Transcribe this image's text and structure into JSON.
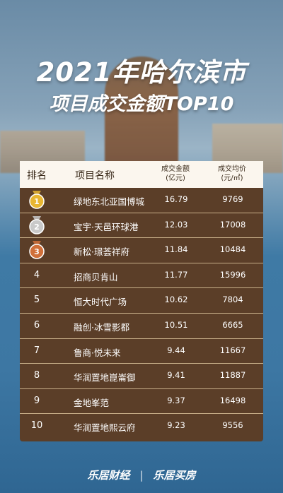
{
  "header": {
    "title_line1": "2021年哈尔滨市",
    "title_line2": "项目成交金额TOP10"
  },
  "table": {
    "columns": {
      "rank": "排名",
      "name": "项目名称",
      "amount_line1": "成交金额",
      "amount_line2": "(亿元)",
      "price_line1": "成交均价",
      "price_line2": "(元/㎡)"
    },
    "rows": [
      {
        "rank": "1",
        "name": "绿地东北亚国博城",
        "amount": "16.79",
        "price": "9769",
        "medal": "gold"
      },
      {
        "rank": "2",
        "name": "宝宇·天邑环球港",
        "amount": "12.03",
        "price": "17008",
        "medal": "silver"
      },
      {
        "rank": "3",
        "name": "新松·璟荟祥府",
        "amount": "11.84",
        "price": "10484",
        "medal": "bronze"
      },
      {
        "rank": "4",
        "name": "招商贝肯山",
        "amount": "11.77",
        "price": "15996"
      },
      {
        "rank": "5",
        "name": "恒大时代广场",
        "amount": "10.62",
        "price": "7804"
      },
      {
        "rank": "6",
        "name": "融创·冰雪影都",
        "amount": "10.51",
        "price": "6665"
      },
      {
        "rank": "7",
        "name": "鲁商·悦未来",
        "amount": "9.44",
        "price": "11667"
      },
      {
        "rank": "8",
        "name": "华润置地崑崙御",
        "amount": "9.41",
        "price": "11887"
      },
      {
        "rank": "9",
        "name": "金地峯范",
        "amount": "9.37",
        "price": "16498"
      },
      {
        "rank": "10",
        "name": "华润置地熙云府",
        "amount": "9.23",
        "price": "9556"
      }
    ]
  },
  "footer": {
    "brand1": "乐居财经",
    "brand2": "乐居买房"
  },
  "colors": {
    "gold": "#e8b632",
    "silver": "#c9c9c9",
    "bronze": "#d0703a",
    "row_bg": "#5b3e28",
    "divider": "#c9b08a"
  }
}
